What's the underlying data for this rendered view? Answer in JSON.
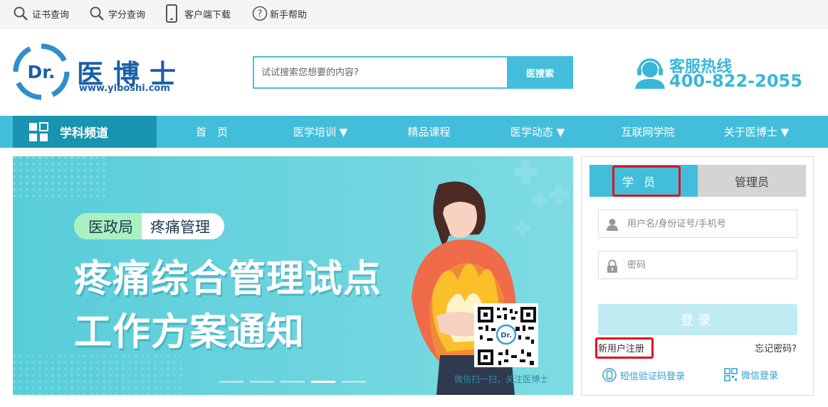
{
  "topbar": {
    "links": [
      {
        "label": "证书查询",
        "icon": "search-icon"
      },
      {
        "label": "学分查询",
        "icon": "search-icon"
      },
      {
        "label": "客户端下载",
        "icon": "mobile-phone-icon"
      },
      {
        "label": "新手帮助",
        "icon": "help-circle-icon"
      }
    ]
  },
  "header": {
    "logo_badge": "Dr.",
    "logo_name": "医博士",
    "logo_url": "www.yiboshi.com",
    "search_placeholder": "试试搜索您想要的内容?",
    "search_button": "医搜索",
    "hotline_title": "客服热线",
    "hotline_number": "400-822-2055"
  },
  "nav": {
    "channel": "学科频道",
    "items": [
      {
        "label": "首　页"
      },
      {
        "label": "医学培训 ▼"
      },
      {
        "label": "精品课程"
      },
      {
        "label": "医学动态 ▼"
      },
      {
        "label": "互联网学院"
      },
      {
        "label": "关于医博士 ▼"
      }
    ]
  },
  "banner": {
    "tag_left": "医政局",
    "tag_right": "疼痛管理",
    "line1": "疼痛综合管理试点",
    "line2": "工作方案通知",
    "caption": "微信扫一扫，关注医博士",
    "slide_count": 5,
    "active_slide": 4
  },
  "login": {
    "tab_student": "学员",
    "tab_admin": "管理员",
    "username_placeholder": "用户名/身份证号/手机号",
    "password_placeholder": "密码",
    "login_button": "登录",
    "register_link": "新用户注册",
    "forgot_link": "忘记密码?",
    "sms_login": "短信验证码登录",
    "wechat_login": "微信登录"
  },
  "colors": {
    "accent": "#42bedb",
    "accent_dark": "#1893b0",
    "brand_blue": "#1a5fa8",
    "highlight_red": "#e0121f"
  }
}
